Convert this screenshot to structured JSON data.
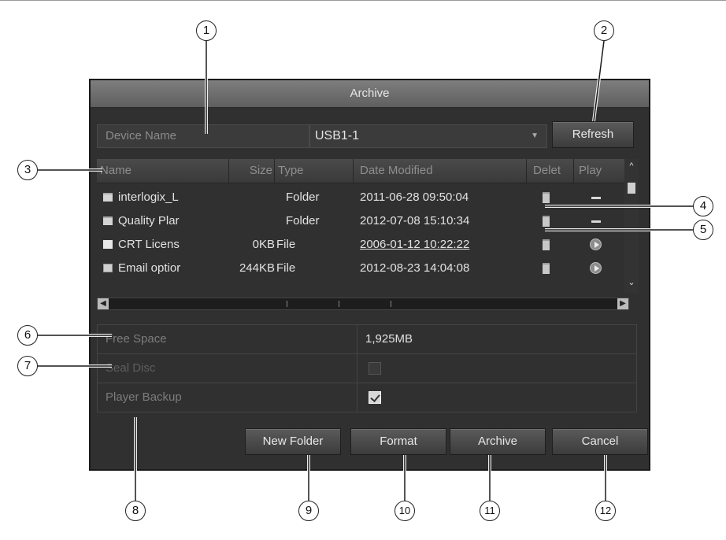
{
  "dialog": {
    "title": "Archive",
    "device_name_label": "Device Name",
    "device_name_value": "USB1-1",
    "refresh_label": "Refresh"
  },
  "file_table": {
    "columns": [
      "Name",
      "Size",
      "Type",
      "Date Modified",
      "Delet",
      "Play"
    ],
    "rows": [
      {
        "name": "interlogix_L",
        "size": "",
        "type": "Folder",
        "date": "2011-06-28 09:50:04",
        "icon": "folder-icon",
        "play": "none"
      },
      {
        "name": "Quality Plar",
        "size": "",
        "type": "Folder",
        "date": "2012-07-08 15:10:34",
        "icon": "folder-icon",
        "play": "none"
      },
      {
        "name": "CRT Licens",
        "size": "0KB",
        "type": "File",
        "date": "2006-01-12 10:22:22",
        "icon": "document-icon",
        "play": "play-icon"
      },
      {
        "name": "Email optior",
        "size": "244KB",
        "type": "File",
        "date": "2012-08-23 14:04:08",
        "icon": "mail-icon",
        "play": "play-icon"
      }
    ]
  },
  "properties": {
    "free_space_label": "Free Space",
    "free_space_value": "1,925MB",
    "seal_disc_label": "Seal Disc",
    "seal_disc_checked": false,
    "player_backup_label": "Player Backup",
    "player_backup_checked": true
  },
  "buttons": {
    "new_folder": "New Folder",
    "format": "Format",
    "archive": "Archive",
    "cancel": "Cancel"
  },
  "callouts": [
    "1",
    "2",
    "3",
    "4",
    "5",
    "6",
    "7",
    "8",
    "9",
    "10",
    "11",
    "12"
  ],
  "colors": {
    "dialog_bg": "#303030",
    "titlebar": "#6e6e6e",
    "label_grey": "#8b8b8b"
  }
}
